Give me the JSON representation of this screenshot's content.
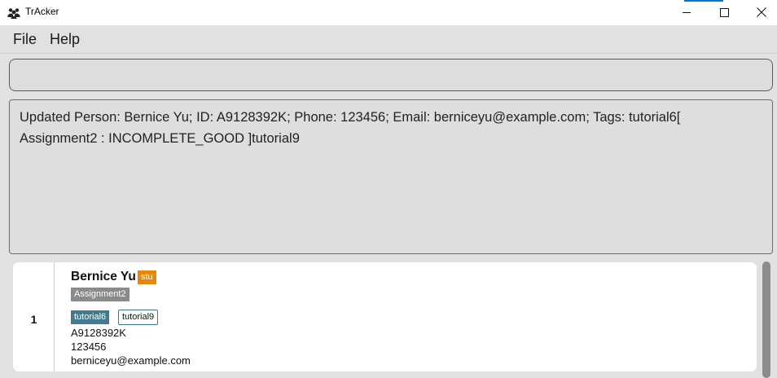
{
  "window": {
    "title": "TrAcker",
    "app_icon": "people-group-icon",
    "controls": [
      "minimize-icon",
      "maximize-icon",
      "close-icon"
    ]
  },
  "menu": {
    "file_label": "File",
    "help_label": "Help"
  },
  "command_box": {
    "value": ""
  },
  "result": {
    "text": "Updated Person: Bernice Yu; ID: A9128392K; Phone: 123456; Email: berniceyu@example.com; Tags: tutorial6[ Assignment2 : INCOMPLETE_GOOD ]tutorial9"
  },
  "person_list": {
    "items": [
      {
        "index": "1",
        "name": "Bernice Yu",
        "role": "stu",
        "assignment": "Assignment2",
        "tags": [
          "tutorial6",
          "tutorial9"
        ],
        "id": "A9128392K",
        "phone": "123456",
        "email": "berniceyu@example.com"
      }
    ]
  },
  "colors": {
    "role_badge": "#e8860c",
    "assignment_badge": "#8a8a8a",
    "tag_badge": "#3e7b91",
    "window_accent": "#0078d7"
  }
}
